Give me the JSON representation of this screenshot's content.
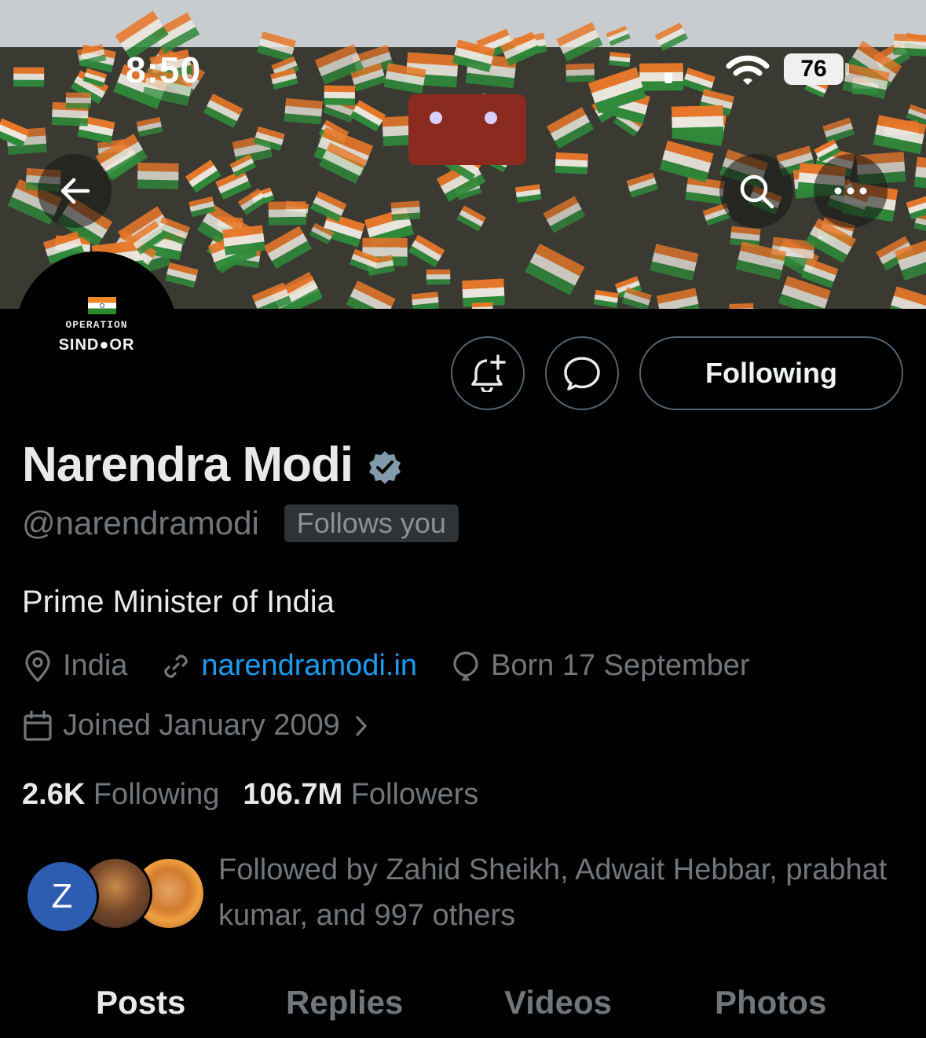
{
  "status_bar": {
    "time": "8:50",
    "battery": "76",
    "icons": [
      "dot-icon",
      "wifi-icon",
      "battery-icon"
    ]
  },
  "header": {
    "back_icon": "arrow-left-icon",
    "search_icon": "search-icon",
    "more_icon": "more-horizontal-icon"
  },
  "avatar": {
    "line1": "OPERATION",
    "line2": "SIND●OR"
  },
  "actions": {
    "notify_icon": "bell-plus-icon",
    "message_icon": "message-bubble-icon",
    "follow_label": "Following"
  },
  "profile": {
    "name": "Narendra Modi",
    "handle": "@narendramodi",
    "follows_you": "Follows you",
    "bio": "Prime Minister of India",
    "location": "India",
    "website": "narendramodi.in",
    "birthday": "Born 17 September",
    "joined": "Joined January 2009"
  },
  "stats": {
    "following_count": "2.6K",
    "following_label": "Following",
    "followers_count": "106.7M",
    "followers_label": "Followers"
  },
  "followed_by": {
    "avatar_letter": "Z",
    "text": "Followed by Zahid Sheikh, Adwait Hebbar, prabhat kumar, and 997 others"
  },
  "tabs": [
    {
      "label": "Posts",
      "active": true
    },
    {
      "label": "Replies",
      "active": false
    },
    {
      "label": "Videos",
      "active": false
    },
    {
      "label": "Photos",
      "active": false
    }
  ],
  "colors": {
    "background": "#000000",
    "text_primary": "#e7e9ea",
    "text_secondary": "#71767b",
    "link": "#1d9bf0",
    "border": "#536471",
    "badge_bg": "#2f3336"
  }
}
